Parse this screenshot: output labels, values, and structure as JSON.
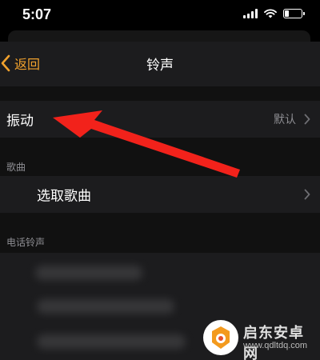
{
  "status_bar": {
    "time": "5:07"
  },
  "nav": {
    "back_label": "返回",
    "title": "铃声"
  },
  "vibration": {
    "label": "振动",
    "value": "默认"
  },
  "songs": {
    "header": "歌曲",
    "pick_label": "选取歌曲"
  },
  "ringtones": {
    "header": "电话铃声"
  },
  "watermark": {
    "name": "启东安卓网",
    "url": "www.qdltdq.com"
  },
  "colors": {
    "accent": "#f0a12d",
    "arrow": "#f2221b",
    "cell_bg": "#1c1c1e"
  }
}
